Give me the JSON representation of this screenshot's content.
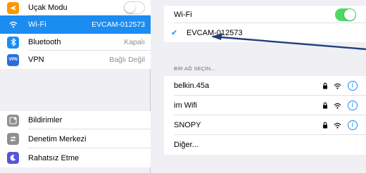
{
  "sidebar": {
    "group1": [
      {
        "label": "Uçak Modu",
        "icon": "airplane-icon",
        "color": "#ff9500",
        "control": "toggle-off"
      },
      {
        "label": "Wi-Fi",
        "icon": "wifi-icon",
        "color": "#1b8cf0",
        "value": "EVCAM-012573",
        "selected": true
      },
      {
        "label": "Bluetooth",
        "icon": "bluetooth-icon",
        "color": "#1b8cf0",
        "value": "Kapalı"
      },
      {
        "label": "VPN",
        "icon": "vpn-icon",
        "icon_text": "VPN",
        "color": "#2c6ee0",
        "value": "Bağlı Değil"
      }
    ],
    "group2": [
      {
        "label": "Bildirimler",
        "icon": "notifications-icon",
        "color": "#8e8e93"
      },
      {
        "label": "Denetim Merkezi",
        "icon": "control-center-icon",
        "color": "#8e8e93"
      },
      {
        "label": "Rahatsız Etme",
        "icon": "do-not-disturb-icon",
        "color": "#5856d6"
      }
    ]
  },
  "wifi_panel": {
    "wifi_label": "Wi-Fi",
    "wifi_enabled": true,
    "connected_network": "EVCAM-012573",
    "section_header": "BİR AĞ SEÇİN...",
    "networks": [
      {
        "name": "belkin.45a",
        "locked": true
      },
      {
        "name": "im Wifi",
        "locked": true
      },
      {
        "name": "SNOPY",
        "locked": true
      }
    ],
    "other_label": "Diğer...",
    "info_glyph": "i"
  },
  "colors": {
    "accent": "#1b8cf0",
    "toggle_on": "#4cd964",
    "annotation_arrow": "#1f3f7a"
  }
}
